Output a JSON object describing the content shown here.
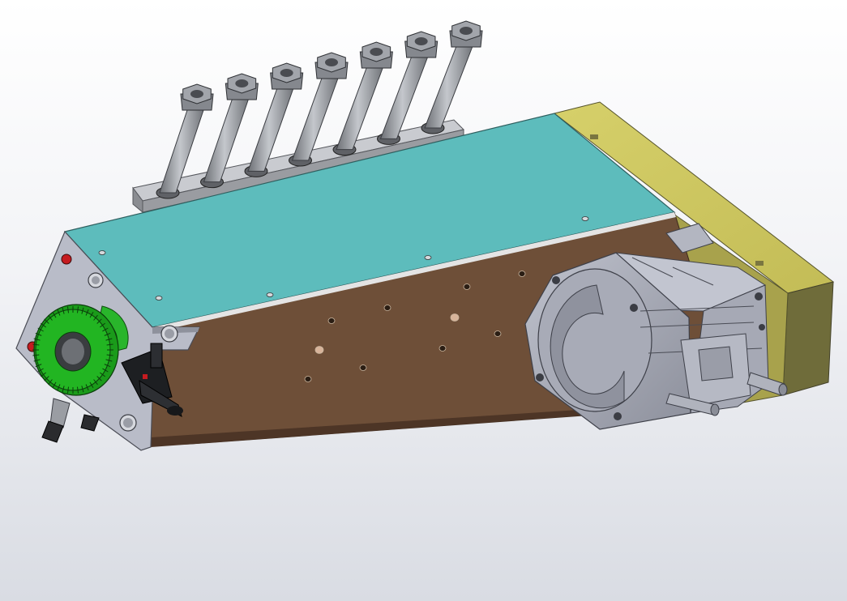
{
  "viewport": {
    "background_top": "#ffffff",
    "background_bottom": "#d9dce3"
  },
  "model": {
    "colors": {
      "top_plate": "#5dbcbc",
      "side_body": "#6e4f38",
      "end_plate": "#b9bcc8",
      "yellow_block": "#c8c25e",
      "motor": "#a9adba",
      "green_wheel": "#1fb51f",
      "fittings": "#9fa2a8"
    },
    "fitting_count": 7
  }
}
